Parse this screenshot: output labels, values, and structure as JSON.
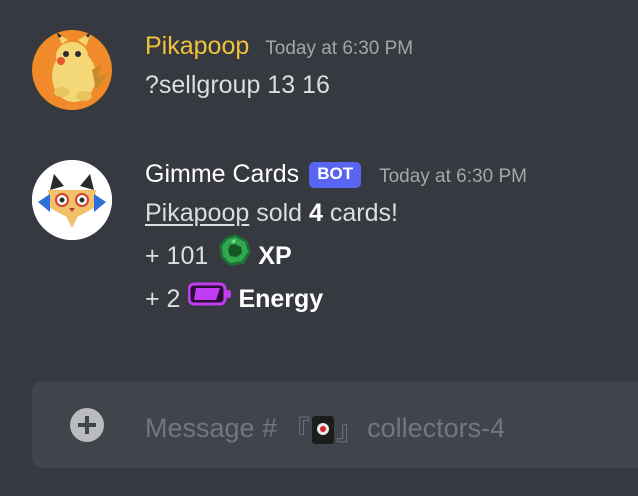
{
  "messages": [
    {
      "username": "Pikapoop",
      "username_color": "#f0c23b",
      "timestamp": "Today at 6:30 PM",
      "content": "?sellgroup 13 16"
    },
    {
      "username": "Gimme Cards",
      "username_color": "#ffffff",
      "badge": "BOT",
      "timestamp": "Today at 6:30 PM",
      "mention": "Pikapoop",
      "sold_prefix": " sold ",
      "sold_count": "4",
      "sold_suffix": " cards!",
      "xp_amount": "+ 101",
      "xp_label": "XP",
      "xp_icon": "green-gem-icon",
      "energy_amount": "+ 2",
      "energy_label": "Energy",
      "energy_icon": "purple-battery-icon"
    }
  ],
  "composer": {
    "placeholder_prefix": "Message #",
    "channel_open_bracket": "『",
    "channel_close_bracket": "』",
    "channel_name": "collectors-4",
    "add_icon": "plus-circle-icon"
  },
  "colors": {
    "background": "#36393f",
    "composer": "#40444b",
    "bot_badge": "#5865f2",
    "xp_gem": "#2fa84f",
    "energy_battery": "#c13cf2"
  }
}
